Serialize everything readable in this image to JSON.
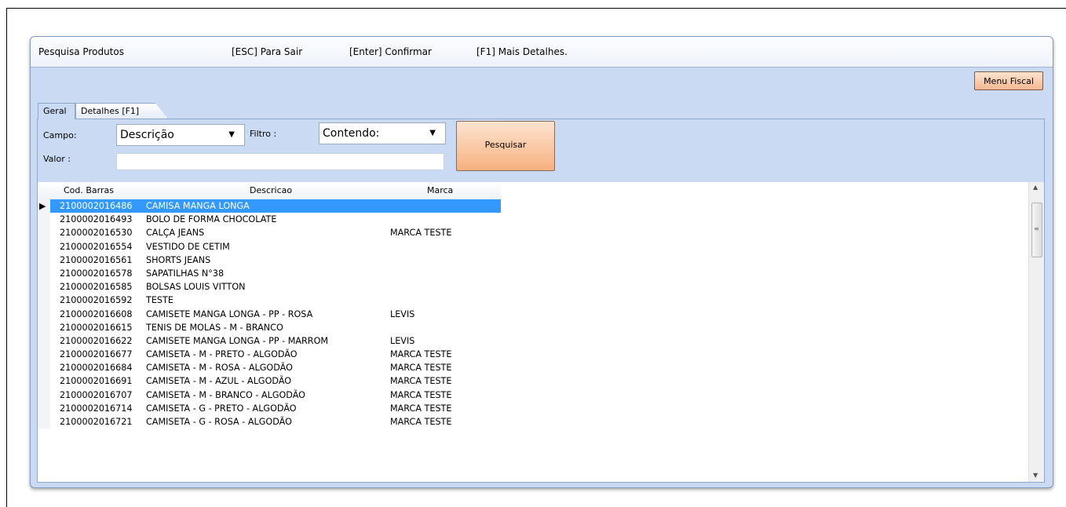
{
  "window": {
    "title": "Pesquisa Produtos",
    "hint_esc": "[ESC] Para Sair",
    "hint_enter": "[Enter] Confirmar",
    "hint_f1": "[F1] Mais Detalhes."
  },
  "toolbar": {
    "menu_fiscal": "Menu Fiscal"
  },
  "tabs": [
    {
      "label": "Geral",
      "active": true
    },
    {
      "label": "Detalhes [F1]",
      "active": false
    }
  ],
  "search": {
    "campo_label": "Campo:",
    "campo_value": "Descrição",
    "filtro_label": "Filtro :",
    "filtro_value": "Contendo:",
    "valor_label": "Valor :",
    "valor_value": "",
    "button": "Pesquisar"
  },
  "grid": {
    "headers": {
      "cod": "Cod. Barras",
      "desc": "Descricao",
      "marca": "Marca"
    },
    "selected_index": 0,
    "rows": [
      {
        "cod": "2100002016486",
        "desc": "CAMISA MANGA LONGA",
        "marca": ""
      },
      {
        "cod": "2100002016493",
        "desc": "BOLO DE FORMA CHOCOLATE",
        "marca": ""
      },
      {
        "cod": "2100002016530",
        "desc": "CALÇA JEANS",
        "marca": "MARCA TESTE"
      },
      {
        "cod": "2100002016554",
        "desc": "VESTIDO DE CETIM",
        "marca": ""
      },
      {
        "cod": "2100002016561",
        "desc": "SHORTS JEANS",
        "marca": ""
      },
      {
        "cod": "2100002016578",
        "desc": "SAPATILHAS N°38",
        "marca": ""
      },
      {
        "cod": "2100002016585",
        "desc": "BOLSAS LOUIS VITTON",
        "marca": ""
      },
      {
        "cod": "2100002016592",
        "desc": "TESTE",
        "marca": ""
      },
      {
        "cod": "2100002016608",
        "desc": "CAMISETE MANGA LONGA - PP - ROSA",
        "marca": "LEVIS"
      },
      {
        "cod": "2100002016615",
        "desc": "TENIS DE MOLAS - M - BRANCO",
        "marca": ""
      },
      {
        "cod": "2100002016622",
        "desc": "CAMISETE MANGA LONGA - PP - MARROM",
        "marca": "LEVIS"
      },
      {
        "cod": "2100002016677",
        "desc": "CAMISETA - M - PRETO - ALGODÃO",
        "marca": "MARCA TESTE"
      },
      {
        "cod": "2100002016684",
        "desc": "CAMISETA - M - ROSA - ALGODÃO",
        "marca": "MARCA TESTE"
      },
      {
        "cod": "2100002016691",
        "desc": "CAMISETA - M - AZUL - ALGODÃO",
        "marca": "MARCA TESTE"
      },
      {
        "cod": "2100002016707",
        "desc": "CAMISETA - M - BRANCO - ALGODÃO",
        "marca": "MARCA TESTE"
      },
      {
        "cod": "2100002016714",
        "desc": "CAMISETA - G - PRETO - ALGODÃO",
        "marca": "MARCA TESTE"
      },
      {
        "cod": "2100002016721",
        "desc": "CAMISETA - G - ROSA - ALGODÃO",
        "marca": "MARCA TESTE"
      }
    ]
  },
  "colors": {
    "panel_bg": "#c9daf2",
    "selection": "#3399ff",
    "button_bg": "#f6b180"
  }
}
